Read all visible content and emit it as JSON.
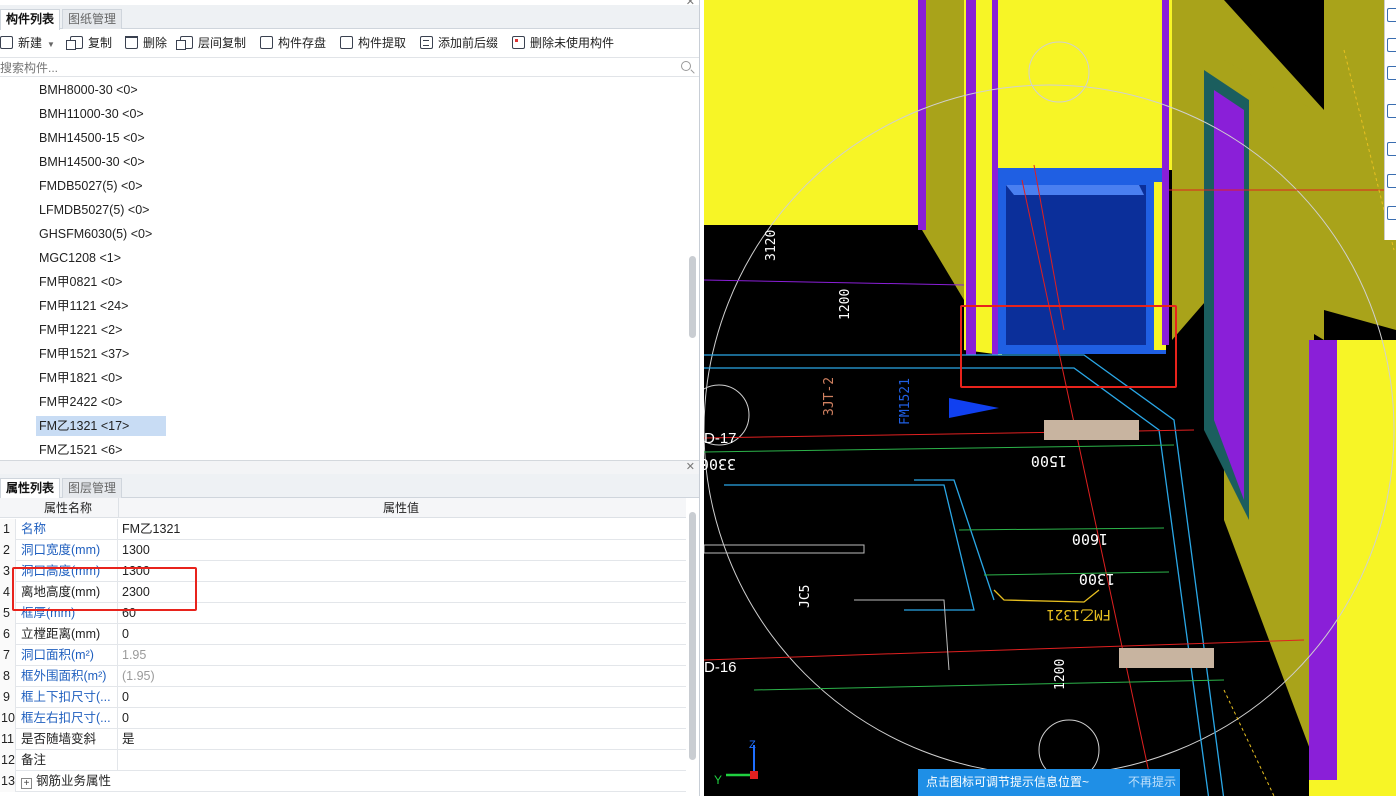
{
  "component_panel": {
    "tabs": [
      "构件列表",
      "图纸管理"
    ],
    "toolbar": {
      "new": "新建",
      "copy": "复制",
      "delete": "删除",
      "floor_copy": "层间复制",
      "save_component": "构件存盘",
      "extract_component": "构件提取",
      "add_prefix_suffix": "添加前后缀",
      "delete_unused": "删除未使用构件"
    },
    "search_placeholder": "搜索构件...",
    "items": [
      "BMH8000-30 <0>",
      "BMH11000-30 <0>",
      "BMH14500-15 <0>",
      "BMH14500-30 <0>",
      "FMDB5027(5) <0>",
      "LFMDB5027(5) <0>",
      "GHSFM6030(5) <0>",
      "MGC1208 <1>",
      "FM甲0821 <0>",
      "FM甲1121 <24>",
      "FM甲1221 <2>",
      "FM甲1521 <37>",
      "FM甲1821 <0>",
      "FM甲2422 <0>",
      "FM乙1321 <17>",
      "FM乙1521 <6>"
    ],
    "selected_item": "FM乙1321 <17>"
  },
  "property_panel": {
    "tabs": [
      "属性列表",
      "图层管理"
    ],
    "header": {
      "name": "属性名称",
      "value": "属性值"
    },
    "rows": [
      {
        "num": "1",
        "name": "名称",
        "value": "FM乙1321"
      },
      {
        "num": "2",
        "name": "洞口宽度(mm)",
        "value": "1300"
      },
      {
        "num": "3",
        "name": "洞口高度(mm)",
        "value": "1300"
      },
      {
        "num": "4",
        "name": "离地高度(mm)",
        "value": "2300"
      },
      {
        "num": "5",
        "name": "框厚(mm)",
        "value": "60"
      },
      {
        "num": "6",
        "name": "立樘距离(mm)",
        "value": "0"
      },
      {
        "num": "7",
        "name": "洞口面积(m²)",
        "value": "1.95"
      },
      {
        "num": "8",
        "name": "框外围面积(m²)",
        "value": "(1.95)"
      },
      {
        "num": "9",
        "name": "框上下扣尺寸(...",
        "value": "0"
      },
      {
        "num": "10",
        "name": "框左右扣尺寸(...",
        "value": "0"
      },
      {
        "num": "11",
        "name": "是否随墙变斜",
        "value": "是"
      },
      {
        "num": "12",
        "name": "备注",
        "value": ""
      },
      {
        "num": "13",
        "name": "钢筋业务属性",
        "value": ""
      }
    ]
  },
  "viewport": {
    "axis_labels": [
      "D-17",
      "D-16"
    ],
    "dimensions": [
      "3300",
      "1500",
      "1600",
      "1300"
    ],
    "door_label": "FM乙1321",
    "rotated_texts": [
      "3120",
      "1200",
      "FM1521",
      "3JT-2",
      "1200",
      "JC5"
    ],
    "axis_indicator": {
      "y": "Y",
      "z": "Z"
    },
    "tip": {
      "message": "点击图标可调节提示信息位置~",
      "dismiss": "不再提示"
    }
  },
  "colors": {
    "wall_yellow": "#f7f526",
    "wall_olive": "#a9a31a",
    "column_purple": "#8a1fd8",
    "door_blue": "#1f5fe3",
    "highlight_red": "#e8231c",
    "selection_bg": "#c8dcf4",
    "tip_blue": "#1f8fe6"
  }
}
